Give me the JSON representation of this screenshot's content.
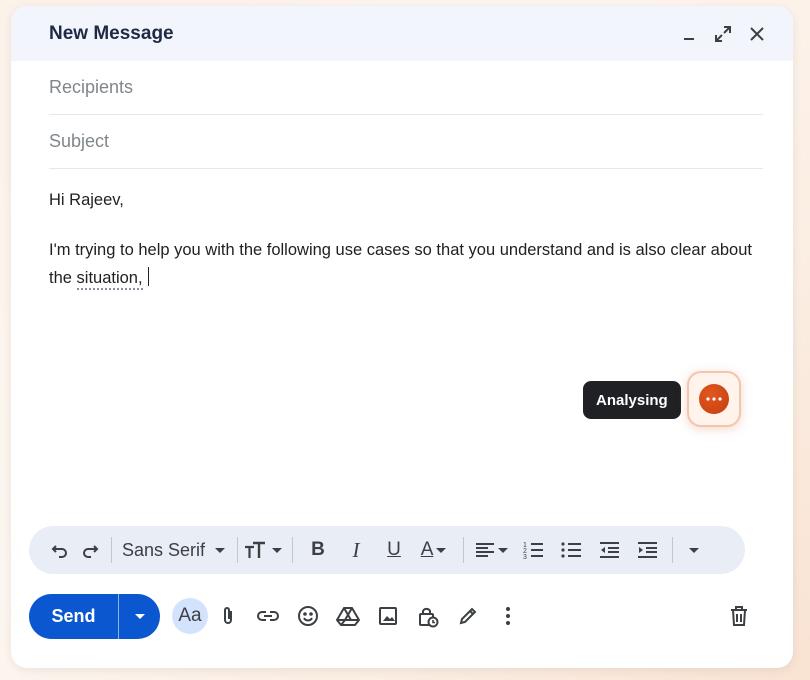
{
  "window": {
    "title": "New Message",
    "controls": [
      "minimize-icon",
      "expand-icon",
      "close-icon"
    ]
  },
  "recipients": {
    "placeholder": "Recipients"
  },
  "subject": {
    "placeholder": "Subject"
  },
  "body": {
    "greeting": "Hi Rajeev,",
    "line_start": "I'm trying to help you with the following use cases so that you understand and is also clear about the ",
    "flagged_word": "situation,"
  },
  "assistant": {
    "status_label": "Analysing",
    "button_icon": "more-dots-icon",
    "accent": "#d4501c"
  },
  "toolbar": {
    "font_name": "Sans Serif",
    "bold_label": "B",
    "italic_label": "I",
    "underline_label": "U",
    "text_color_label": "A",
    "text_size_label": "TT"
  },
  "footer": {
    "send_label": "Send",
    "format_label": "Aa",
    "send_color": "#0b57d0"
  }
}
